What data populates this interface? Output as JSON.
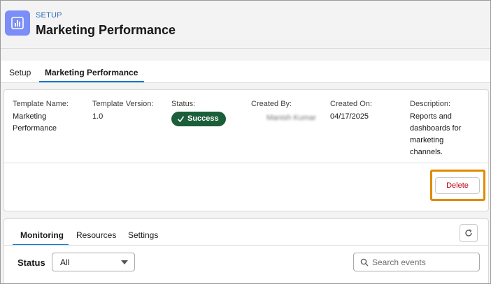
{
  "header": {
    "breadcrumb": "SETUP",
    "title": "Marketing Performance",
    "icon": "analytics-chart-icon",
    "icon_color": "#7b8ef7"
  },
  "tabs": [
    {
      "label": "Setup",
      "active": false
    },
    {
      "label": "Marketing Performance",
      "active": true
    }
  ],
  "details": {
    "template_name": {
      "label": "Template Name:",
      "value_line1": "Marketing",
      "value_line2": "Performance"
    },
    "template_version": {
      "label": "Template Version:",
      "value": "1.0"
    },
    "status": {
      "label": "Status:",
      "value": "Success",
      "color": "#1b5e3a"
    },
    "created_by": {
      "label": "Created By:",
      "value": "Manish Kumar"
    },
    "created_on": {
      "label": "Created On:",
      "value": "04/17/2025"
    },
    "description": {
      "label": "Description:",
      "lines": [
        "Reports and",
        "dashboards for",
        "marketing",
        "channels."
      ]
    },
    "delete_label": "Delete",
    "highlight_color": "#e08a00"
  },
  "panel": {
    "tabs": [
      {
        "label": "Monitoring",
        "active": true
      },
      {
        "label": "Resources",
        "active": false
      },
      {
        "label": "Settings",
        "active": false
      }
    ],
    "filter_label": "Status",
    "filter_value": "All",
    "search_placeholder": "Search events",
    "accent_color": "#0176d3"
  }
}
